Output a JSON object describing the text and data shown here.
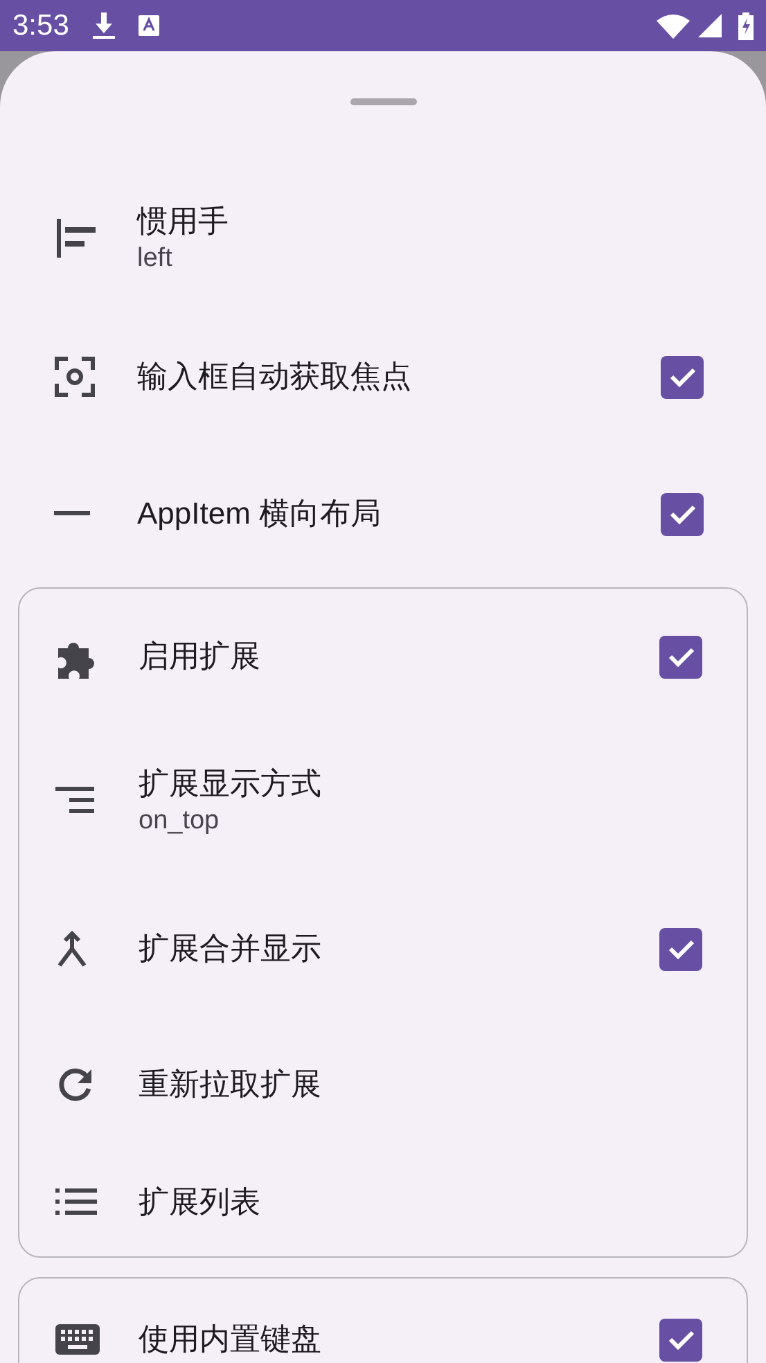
{
  "status_bar": {
    "time": "3:53"
  },
  "sections": [
    {
      "framed": false,
      "items": [
        {
          "title": "惯用手",
          "subtitle": "left"
        },
        {
          "title": "输入框自动获取焦点",
          "checked": true
        },
        {
          "title": "AppItem 横向布局",
          "checked": true
        }
      ]
    },
    {
      "framed": true,
      "items": [
        {
          "title": "启用扩展",
          "checked": true
        },
        {
          "title": "扩展显示方式",
          "subtitle": "on_top"
        },
        {
          "title": "扩展合并显示",
          "checked": true
        },
        {
          "title": "重新拉取扩展"
        },
        {
          "title": "扩展列表"
        }
      ]
    },
    {
      "framed": true,
      "items": [
        {
          "title": "使用内置键盘",
          "checked": true
        }
      ]
    }
  ]
}
